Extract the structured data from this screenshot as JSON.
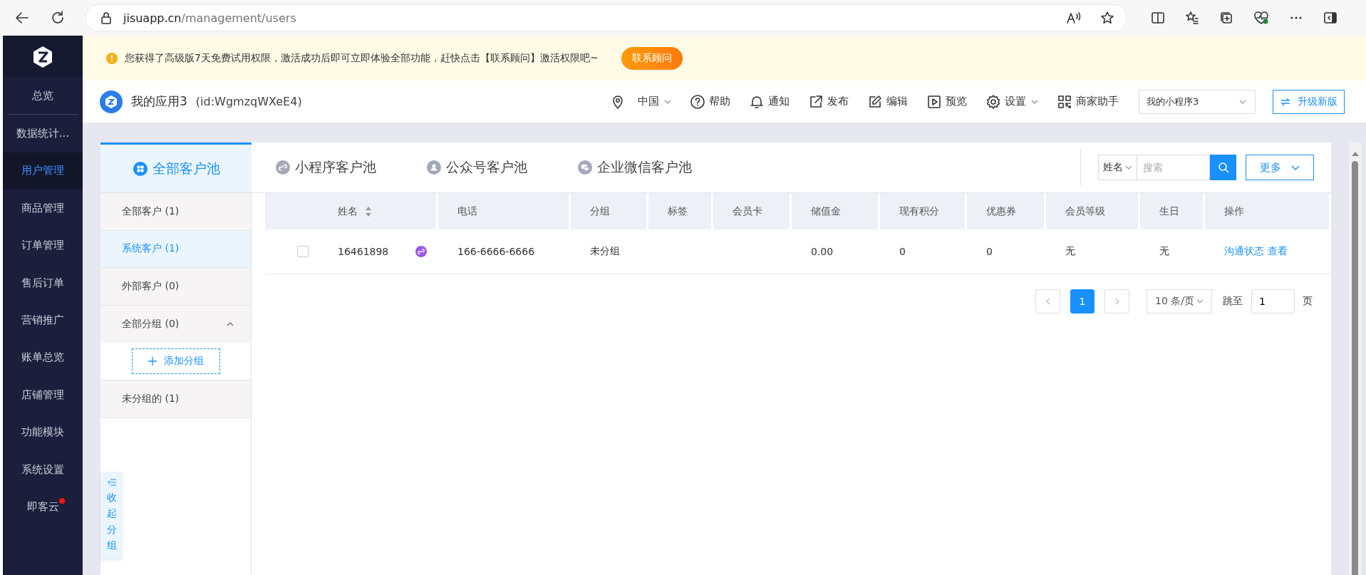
{
  "browser": {
    "url_host": "jisuapp.cn",
    "url_path": "/management/users"
  },
  "sidebar": {
    "items": [
      {
        "label": "总览",
        "selected": false,
        "dot": false
      },
      {
        "label": "数据统计...",
        "selected": false,
        "dot": false
      },
      {
        "label": "用户管理",
        "selected": true,
        "dot": false
      },
      {
        "label": "商品管理",
        "selected": false,
        "dot": false
      },
      {
        "label": "订单管理",
        "selected": false,
        "dot": false
      },
      {
        "label": "售后订单",
        "selected": false,
        "dot": false
      },
      {
        "label": "营销推广",
        "selected": false,
        "dot": false
      },
      {
        "label": "账单总览",
        "selected": false,
        "dot": false
      },
      {
        "label": "店铺管理",
        "selected": false,
        "dot": false
      },
      {
        "label": "功能模块",
        "selected": false,
        "dot": false
      },
      {
        "label": "系统设置",
        "selected": false,
        "dot": false
      },
      {
        "label": "即客云",
        "selected": false,
        "dot": true
      }
    ]
  },
  "banner": {
    "message": "您获得了高级版7天免费试用权限，激活成功后即可立即体验全部功能，赶快点击【联系顾问】激活权限吧~",
    "button": "联系顾问"
  },
  "header": {
    "app_name": "我的应用3",
    "app_id": "(id:WgmzqWXeE4)",
    "nav": [
      {
        "label": "中国",
        "dropdown": true
      },
      {
        "label": "帮助",
        "dropdown": false
      },
      {
        "label": "通知",
        "dropdown": false
      },
      {
        "label": "发布",
        "dropdown": false
      },
      {
        "label": "编辑",
        "dropdown": false
      },
      {
        "label": "预览",
        "dropdown": false
      },
      {
        "label": "设置",
        "dropdown": true
      },
      {
        "label": "商家助手",
        "dropdown": false
      }
    ],
    "program_select": "我的小程序3",
    "upgrade_button": "升级新版"
  },
  "tabs": [
    {
      "label": "全部客户池",
      "selected": true
    },
    {
      "label": "小程序客户池",
      "selected": false
    },
    {
      "label": "公众号客户池",
      "selected": false
    },
    {
      "label": "企业微信客户池",
      "selected": false
    }
  ],
  "search": {
    "field": "姓名",
    "placeholder": "搜索",
    "more_button": "更多"
  },
  "groups": [
    {
      "kind": "item",
      "label": "全部客户 (1)",
      "selected": false
    },
    {
      "kind": "item",
      "label": "系统客户 (1)",
      "selected": true
    },
    {
      "kind": "item",
      "label": "外部客户 (0)",
      "selected": false
    },
    {
      "kind": "folder",
      "label": "全部分组 (0)",
      "expanded": true,
      "children": [
        {
          "kind": "add",
          "label": "添加分组"
        }
      ]
    },
    {
      "kind": "item",
      "label": "未分组的 (1)",
      "selected": false
    }
  ],
  "collapse_button": "收起分组",
  "table": {
    "columns": [
      {
        "label": "姓名",
        "sortable": true
      },
      {
        "label": "电话",
        "sortable": false
      },
      {
        "label": "分组",
        "sortable": false
      },
      {
        "label": "标签",
        "sortable": false
      },
      {
        "label": "会员卡",
        "sortable": false
      },
      {
        "label": "储值金",
        "sortable": false
      },
      {
        "label": "现有积分",
        "sortable": false
      },
      {
        "label": "优惠券",
        "sortable": false
      },
      {
        "label": "会员等级",
        "sortable": false
      },
      {
        "label": "生日",
        "sortable": false
      },
      {
        "label": "操作",
        "sortable": false
      }
    ],
    "rows": [
      {
        "checked": false,
        "name": "16461898",
        "phone": "166-6666-6666",
        "group": "未分组",
        "stored_value": "0.00",
        "points": "0",
        "coupons": "0",
        "member_level": "无",
        "birthday": "无",
        "actions": [
          "沟通状态",
          "查看"
        ]
      }
    ]
  },
  "pagination": {
    "pages": [
      {
        "label": "1",
        "selected": true
      }
    ],
    "page_size": "10 条/页",
    "jump_label": "跳至",
    "jump_value": "1",
    "page_suffix": "页"
  }
}
